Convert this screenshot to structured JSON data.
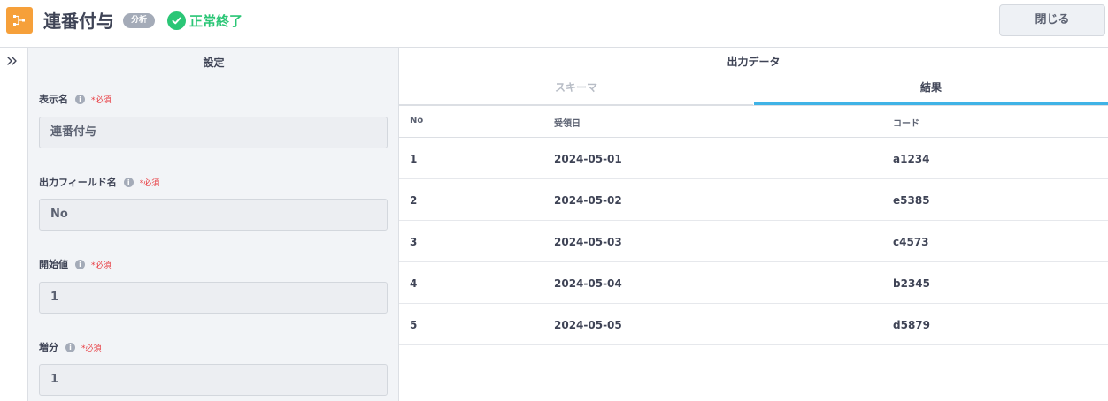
{
  "header": {
    "title": "連番付与",
    "category_badge": "分析",
    "status_text": "正常終了",
    "close_label": "閉じる",
    "app_icon": "sequence-icon",
    "status_icon": "check-circle-icon"
  },
  "colors": {
    "accent_orange": "#f6a03a",
    "success_green": "#2bc676",
    "tab_active_blue": "#3fb3e6",
    "required_red": "#e8383d"
  },
  "settings": {
    "title": "設定",
    "required_label": "*必須",
    "fields": [
      {
        "label": "表示名",
        "value": "連番付与"
      },
      {
        "label": "出力フィールド名",
        "value": "No"
      },
      {
        "label": "開始値",
        "value": "1"
      },
      {
        "label": "増分",
        "value": "1"
      }
    ]
  },
  "output": {
    "title": "出力データ",
    "tabs": [
      {
        "label": "スキーマ",
        "active": false
      },
      {
        "label": "結果",
        "active": true
      }
    ],
    "columns": [
      "No",
      "受領日",
      "コード"
    ],
    "rows": [
      [
        "1",
        "2024-05-01",
        "a1234"
      ],
      [
        "2",
        "2024-05-02",
        "e5385"
      ],
      [
        "3",
        "2024-05-03",
        "c4573"
      ],
      [
        "4",
        "2024-05-04",
        "b2345"
      ],
      [
        "5",
        "2024-05-05",
        "d5879"
      ]
    ]
  }
}
